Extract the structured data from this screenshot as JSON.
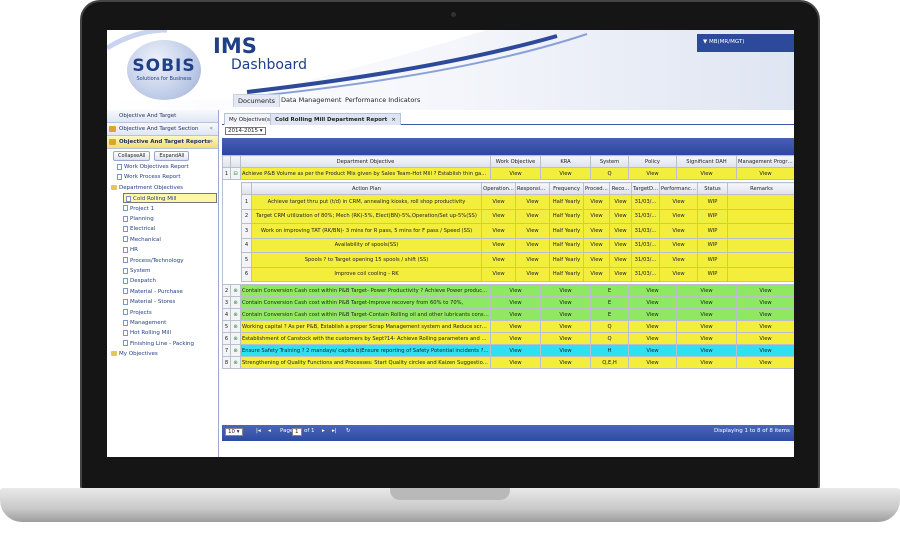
{
  "app": {
    "logo_title": "SOBIS",
    "logo_sub": "Solutions for Business",
    "ims": "IMS",
    "dashboard": "Dashboard",
    "user": "MB(MR/MGT)"
  },
  "nav": {
    "tabs": [
      "Documents",
      "Data Management",
      "Performance Indicators"
    ]
  },
  "sidebar": {
    "sections": [
      "Objective And Target",
      "Objective And Target Section",
      "Objective And Target Reports"
    ],
    "collapse_all": "CollapseAll",
    "expand_all": "ExpandAll",
    "tree": [
      {
        "label": "Work Objectives Report",
        "type": "doc"
      },
      {
        "label": "Work Process Report",
        "type": "doc"
      },
      {
        "label": "Department Objectives",
        "type": "folder"
      },
      {
        "label": "Cold Rolling Mill",
        "type": "doc"
      },
      {
        "label": "Project 1",
        "type": "doc"
      },
      {
        "label": "Planning",
        "type": "doc"
      },
      {
        "label": "Electrical",
        "type": "doc"
      },
      {
        "label": "Mechanical",
        "type": "doc"
      },
      {
        "label": "HR",
        "type": "doc"
      },
      {
        "label": "Process/Technology",
        "type": "doc"
      },
      {
        "label": "System",
        "type": "doc"
      },
      {
        "label": "Despatch",
        "type": "doc"
      },
      {
        "label": "Material - Purchase",
        "type": "doc"
      },
      {
        "label": "Material - Stores",
        "type": "doc"
      },
      {
        "label": "Projects",
        "type": "doc"
      },
      {
        "label": "Management",
        "type": "doc"
      },
      {
        "label": "Hot Rolling Mill",
        "type": "doc"
      },
      {
        "label": "Finishing Line - Packing",
        "type": "doc"
      },
      {
        "label": "My Objectives",
        "type": "folder"
      }
    ]
  },
  "main": {
    "tabs": [
      "My Objective(s)",
      "Cold Rolling Mill Department Report"
    ],
    "year": "2014-2015",
    "columns": [
      "Department Objective",
      "Work Objective",
      "KRA",
      "System",
      "Policy",
      "Significant DAH",
      "Management Program..."
    ],
    "sub_columns": [
      "Action Plan",
      "Operation...",
      "Responsibl...",
      "Frequency",
      "Procedu...",
      "Reco...",
      "TargetD...",
      "Performance I...",
      "Status",
      "Remarks"
    ],
    "rows": [
      {
        "num": "1",
        "icon": "⊟",
        "objective": "Achieve P&B Volume as per the Product Mix given by Sales Team-Hot Mill ? Establish thin gauge r...",
        "work": "View",
        "kra": "View",
        "system": "Q",
        "policy": "View",
        "dah": "View",
        "mgmt": "View",
        "color": "ylw"
      },
      {
        "num": "2",
        "icon": "⊕",
        "objective": "Contain Conversion Cash cost within P&B Target- Power Productivity ? Achieve Power productivit...",
        "work": "View",
        "kra": "View",
        "system": "E",
        "policy": "View",
        "dah": "View",
        "mgmt": "View",
        "color": "grn"
      },
      {
        "num": "3",
        "icon": "⊕",
        "objective": "Contain Conversion Cash cost within P&B Target-Improve recovery from 60% to 70%,",
        "work": "View",
        "kra": "View",
        "system": "E",
        "policy": "View",
        "dah": "View",
        "mgmt": "View",
        "color": "grn"
      },
      {
        "num": "4",
        "icon": "⊕",
        "objective": "Contain Conversion Cash cost within P&B Target-Contain Rolling oil and other lubricants consump...",
        "work": "View",
        "kra": "View",
        "system": "E",
        "policy": "View",
        "dah": "View",
        "mgmt": "View",
        "color": "grn"
      },
      {
        "num": "5",
        "icon": "⊕",
        "objective": "Working capital ? As per P&B, Establish a proper Scrap Management system and Reduce scrap inv...",
        "work": "View",
        "kra": "View",
        "system": "Q",
        "policy": "View",
        "dah": "View",
        "mgmt": "View",
        "color": "ylw"
      },
      {
        "num": "6",
        "icon": "⊕",
        "objective": "Establishment of Canstock with the customers by Sept?14- Achieve Rolling parameters and Mech...",
        "work": "View",
        "kra": "View",
        "system": "Q",
        "policy": "View",
        "dah": "View",
        "mgmt": "View",
        "color": "ylw"
      },
      {
        "num": "7",
        "icon": "⊕",
        "objective": "Ensure Safety Training ? 2 mandays/ capita b)Ensure reporting of Safety Potential incidents ? 1 / c...",
        "work": "View",
        "kra": "View",
        "system": "H",
        "policy": "View",
        "dah": "View",
        "mgmt": "View",
        "color": "cyn"
      },
      {
        "num": "8",
        "icon": "⊕",
        "objective": "Strengthening of Quality Functions and Processes: Start Quality circles and Kaizen Suggestion Sch...",
        "work": "View",
        "kra": "View",
        "system": "Q,E,H",
        "policy": "View",
        "dah": "View",
        "mgmt": "View",
        "color": "ylw"
      }
    ],
    "action_plans": [
      {
        "num": "1",
        "plan": "Achieve target thru put (t/d) in CRM, annealing kiosks, roll shop productivity",
        "op": "View",
        "resp": "View",
        "freq": "Half Yearly",
        "proc": "View",
        "rec": "View",
        "target": "31/03/...",
        "perf": "View",
        "status": "WIP",
        "remarks": ""
      },
      {
        "num": "2",
        "plan": "Target CRM utilization of 80%; Mech (RK)-5%, Elect(BN)-5%,Operation/Set up-5%(SS)",
        "op": "View",
        "resp": "View",
        "freq": "Half Yearly",
        "proc": "View",
        "rec": "View",
        "target": "31/03/...",
        "perf": "View",
        "status": "WIP",
        "remarks": ""
      },
      {
        "num": "3",
        "plan": "Work on improving TAT (RK/BN)- 3 mins for R pass, 5 mins for F pass / Speed (SS)",
        "op": "View",
        "resp": "View",
        "freq": "Half Yearly",
        "proc": "View",
        "rec": "View",
        "target": "31/03/...",
        "perf": "View",
        "status": "WIP",
        "remarks": ""
      },
      {
        "num": "4",
        "plan": "Availability of spools(SS)",
        "op": "View",
        "resp": "View",
        "freq": "Half Yearly",
        "proc": "View",
        "rec": "View",
        "target": "31/03/...",
        "perf": "View",
        "status": "WIP",
        "remarks": ""
      },
      {
        "num": "5",
        "plan": "Spools ? to Target opening 15 spools / shift (SS)",
        "op": "View",
        "resp": "View",
        "freq": "Half Yearly",
        "proc": "View",
        "rec": "View",
        "target": "31/03/...",
        "perf": "View",
        "status": "WIP",
        "remarks": ""
      },
      {
        "num": "6",
        "plan": "Improve coil cooling - RK",
        "op": "View",
        "resp": "View",
        "freq": "Half Yearly",
        "proc": "View",
        "rec": "View",
        "target": "31/03/...",
        "perf": "View",
        "status": "WIP",
        "remarks": ""
      }
    ],
    "pager": {
      "page_size": "10",
      "page_label": "Page",
      "page": "1",
      "of": "of 1",
      "display": "Displaying 1 to 8 of 8 items"
    }
  }
}
